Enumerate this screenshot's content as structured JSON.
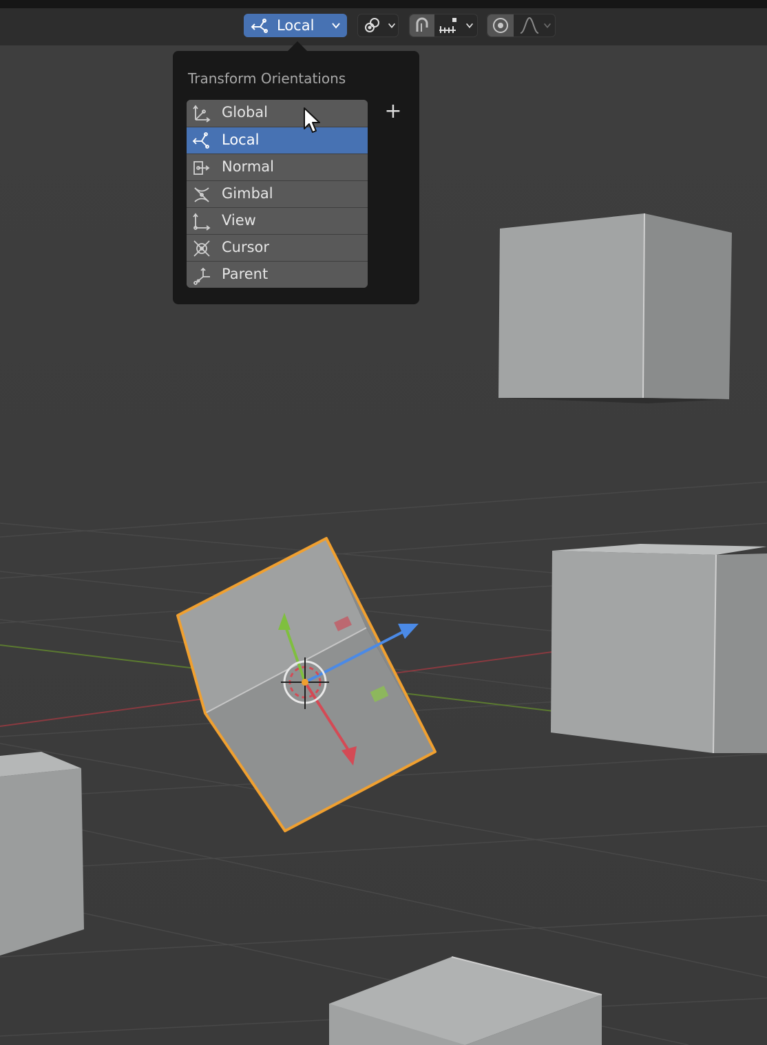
{
  "toolbar": {
    "orientation_label": "Local"
  },
  "popup": {
    "title": "Transform Orientations",
    "add_label": "+",
    "items": [
      {
        "label": "Global",
        "icon": "global-orientation-icon"
      },
      {
        "label": "Local",
        "icon": "local-orientation-icon",
        "selected": true
      },
      {
        "label": "Normal",
        "icon": "normal-orientation-icon"
      },
      {
        "label": "Gimbal",
        "icon": "gimbal-orientation-icon"
      },
      {
        "label": "View",
        "icon": "view-orientation-icon"
      },
      {
        "label": "Cursor",
        "icon": "cursor-orientation-icon"
      },
      {
        "label": "Parent",
        "icon": "parent-orientation-icon"
      }
    ]
  },
  "colors": {
    "accent": "#4772b3",
    "selection_outline": "#f0a030",
    "axis_x": "#d44a55",
    "axis_y": "#7fbf3f",
    "axis_z": "#4b8ae6"
  }
}
